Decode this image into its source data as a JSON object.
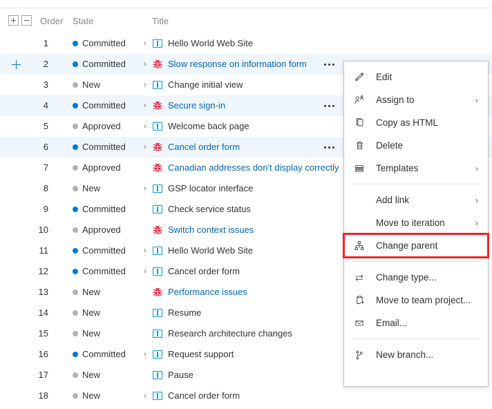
{
  "grid": {
    "columns": {
      "order": "Order",
      "state": "State",
      "title": "Title"
    },
    "expand_all_tooltip": "+",
    "collapse_all_tooltip": "−",
    "colors": {
      "selected_row": "#eff6fc",
      "committed_dot": "#007acc",
      "inactive_dot": "#b2b2b2",
      "link": "#0067b8",
      "story_icon": "#009ccc",
      "bug_icon": "#e2253d",
      "highlight_box": "#e8252a"
    },
    "rows": [
      {
        "order": "1",
        "state": "Committed",
        "state_kind": "committed",
        "title": "Hello World Web Site",
        "type": "story",
        "expandable": true,
        "selected": false,
        "has_menu": false
      },
      {
        "order": "2",
        "state": "Committed",
        "state_kind": "committed",
        "title": "Slow response on information form",
        "type": "bug",
        "expandable": true,
        "selected": true,
        "has_menu": true,
        "has_add": true
      },
      {
        "order": "3",
        "state": "New",
        "state_kind": "inactive",
        "title": "Change initial view",
        "type": "story",
        "expandable": true,
        "selected": false,
        "has_menu": false
      },
      {
        "order": "4",
        "state": "Committed",
        "state_kind": "committed",
        "title": "Secure sign-in",
        "type": "bug",
        "expandable": true,
        "selected": true,
        "has_menu": true
      },
      {
        "order": "5",
        "state": "Approved",
        "state_kind": "inactive",
        "title": "Welcome back page",
        "type": "story",
        "expandable": true,
        "selected": false,
        "has_menu": false
      },
      {
        "order": "6",
        "state": "Committed",
        "state_kind": "committed",
        "title": "Cancel order form",
        "type": "bug",
        "expandable": true,
        "selected": true,
        "has_menu": true
      },
      {
        "order": "7",
        "state": "Approved",
        "state_kind": "inactive",
        "title": "Canadian addresses don't display correctly",
        "type": "bug",
        "expandable": false,
        "selected": false,
        "has_menu": false
      },
      {
        "order": "8",
        "state": "New",
        "state_kind": "inactive",
        "title": "GSP locator interface",
        "type": "story",
        "expandable": true,
        "selected": false,
        "has_menu": false
      },
      {
        "order": "9",
        "state": "Committed",
        "state_kind": "committed",
        "title": "Check service status",
        "type": "story",
        "expandable": false,
        "selected": false,
        "has_menu": false
      },
      {
        "order": "10",
        "state": "Approved",
        "state_kind": "inactive",
        "title": "Switch context issues",
        "type": "bug",
        "expandable": false,
        "selected": false,
        "has_menu": false
      },
      {
        "order": "11",
        "state": "Committed",
        "state_kind": "committed",
        "title": "Hello World Web Site",
        "type": "story",
        "expandable": true,
        "selected": false,
        "has_menu": false
      },
      {
        "order": "12",
        "state": "Committed",
        "state_kind": "committed",
        "title": "Cancel order form",
        "type": "story",
        "expandable": true,
        "selected": false,
        "has_menu": false
      },
      {
        "order": "13",
        "state": "New",
        "state_kind": "inactive",
        "title": "Performance issues",
        "type": "bug",
        "expandable": false,
        "selected": false,
        "has_menu": false
      },
      {
        "order": "14",
        "state": "New",
        "state_kind": "inactive",
        "title": "Resume",
        "type": "story",
        "expandable": false,
        "selected": false,
        "has_menu": false
      },
      {
        "order": "15",
        "state": "New",
        "state_kind": "inactive",
        "title": "Research architecture changes",
        "type": "story",
        "expandable": false,
        "selected": false,
        "has_menu": false
      },
      {
        "order": "16",
        "state": "Committed",
        "state_kind": "committed",
        "title": "Request support",
        "type": "story",
        "expandable": true,
        "selected": false,
        "has_menu": false
      },
      {
        "order": "17",
        "state": "New",
        "state_kind": "inactive",
        "title": "Pause",
        "type": "story",
        "expandable": false,
        "selected": false,
        "has_menu": false
      },
      {
        "order": "18",
        "state": "New",
        "state_kind": "inactive",
        "title": "Cancel order form",
        "type": "story",
        "expandable": true,
        "selected": false,
        "has_menu": false
      }
    ]
  },
  "context_menu": {
    "items": [
      {
        "label": "Edit",
        "icon": "pencil-icon",
        "submenu": false,
        "highlighted": false,
        "separator_after": false
      },
      {
        "label": "Assign to",
        "icon": "assign-person-icon",
        "submenu": true,
        "highlighted": false,
        "separator_after": false
      },
      {
        "label": "Copy as HTML",
        "icon": "copy-icon",
        "submenu": false,
        "highlighted": false,
        "separator_after": false
      },
      {
        "label": "Delete",
        "icon": "trash-icon",
        "submenu": false,
        "highlighted": false,
        "separator_after": false
      },
      {
        "label": "Templates",
        "icon": "templates-icon",
        "submenu": true,
        "highlighted": false,
        "separator_after": true
      },
      {
        "label": "Add link",
        "icon": "none",
        "submenu": true,
        "highlighted": false,
        "separator_after": false
      },
      {
        "label": "Move to iteration",
        "icon": "none",
        "submenu": true,
        "highlighted": false,
        "separator_after": false
      },
      {
        "label": "Change parent",
        "icon": "hierarchy-icon",
        "submenu": false,
        "highlighted": true,
        "separator_after": true
      },
      {
        "label": "Change type...",
        "icon": "swap-arrows-icon",
        "submenu": false,
        "highlighted": false,
        "separator_after": false
      },
      {
        "label": "Move to team project...",
        "icon": "clipboard-move-icon",
        "submenu": false,
        "highlighted": false,
        "separator_after": false
      },
      {
        "label": "Email...",
        "icon": "envelope-icon",
        "submenu": false,
        "highlighted": false,
        "separator_after": true
      },
      {
        "label": "New branch...",
        "icon": "branch-icon",
        "submenu": false,
        "highlighted": false,
        "separator_after": false
      }
    ],
    "chevron_glyph": "›"
  }
}
